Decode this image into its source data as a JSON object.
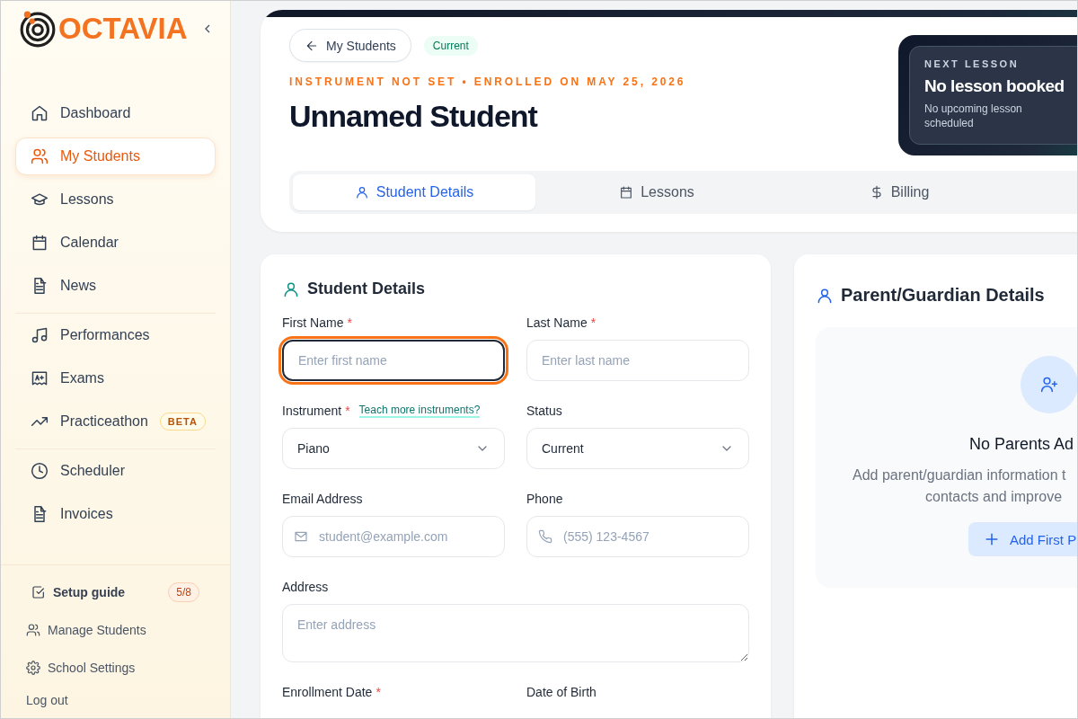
{
  "sidebar": {
    "logo": "OCTAVIA",
    "nav_groups": [
      {
        "items": [
          {
            "label": "Dashboard",
            "selected": false
          },
          {
            "label": "My Students",
            "selected": true
          },
          {
            "label": "Lessons",
            "selected": false
          },
          {
            "label": "Calendar",
            "selected": false
          },
          {
            "label": "News",
            "selected": false
          }
        ]
      },
      {
        "items": [
          {
            "label": "Performances",
            "selected": false
          },
          {
            "label": "Exams",
            "selected": false
          },
          {
            "label": "Practiceathon",
            "selected": false,
            "badge": "BETA"
          }
        ]
      },
      {
        "items": [
          {
            "label": "Scheduler",
            "selected": false
          },
          {
            "label": "Invoices",
            "selected": false
          }
        ]
      }
    ],
    "footer": {
      "setup_guide": {
        "label": "Setup guide",
        "progress": "5/8"
      },
      "links": [
        "Manage Students",
        "School Settings"
      ],
      "logout": "Log out"
    }
  },
  "header": {
    "back": "My Students",
    "status": "Current",
    "meta": "INSTRUMENT NOT SET • ENROLLED ON MAY 25, 2026",
    "title": "Unnamed Student",
    "next_lesson": {
      "label": "NEXT LESSON",
      "title": "No lesson booked",
      "note": "No upcoming lesson scheduled"
    },
    "tabs": [
      {
        "label": "Student Details",
        "selected": true
      },
      {
        "label": "Lessons",
        "selected": false
      },
      {
        "label": "Billing",
        "selected": false
      }
    ]
  },
  "student_details": {
    "title": "Student Details",
    "fields": [
      {
        "kind": "text",
        "label": "First Name",
        "required_mark": "*",
        "placeholder": "Enter first name",
        "focused": true
      },
      {
        "kind": "text",
        "label": "Last Name",
        "required_mark": "*",
        "placeholder": "Enter last name",
        "focused": false
      },
      {
        "kind": "select",
        "label": "Instrument",
        "required_mark": "*",
        "link": "Teach more instruments?",
        "value": "Piano"
      },
      {
        "kind": "select",
        "label": "Status",
        "value": "Current"
      },
      {
        "kind": "email",
        "label": "Email Address",
        "placeholder": "student@example.com",
        "focused": false
      },
      {
        "kind": "phone",
        "label": "Phone",
        "placeholder": "(555) 123-4567",
        "focused": false
      },
      {
        "kind": "textarea",
        "label": "Address",
        "placeholder": "Enter address",
        "focused": false
      },
      {
        "kind": "date",
        "label": "Enrollment Date",
        "required_mark": "*"
      },
      {
        "kind": "date",
        "label": "Date of Birth"
      }
    ]
  },
  "parents": {
    "title": "Parent/Guardian Details",
    "empty_title": "No Parents Ad",
    "empty_lines": [
      "Add parent/guardian information t",
      "contacts and improve"
    ],
    "add_button": "Add First P"
  }
}
